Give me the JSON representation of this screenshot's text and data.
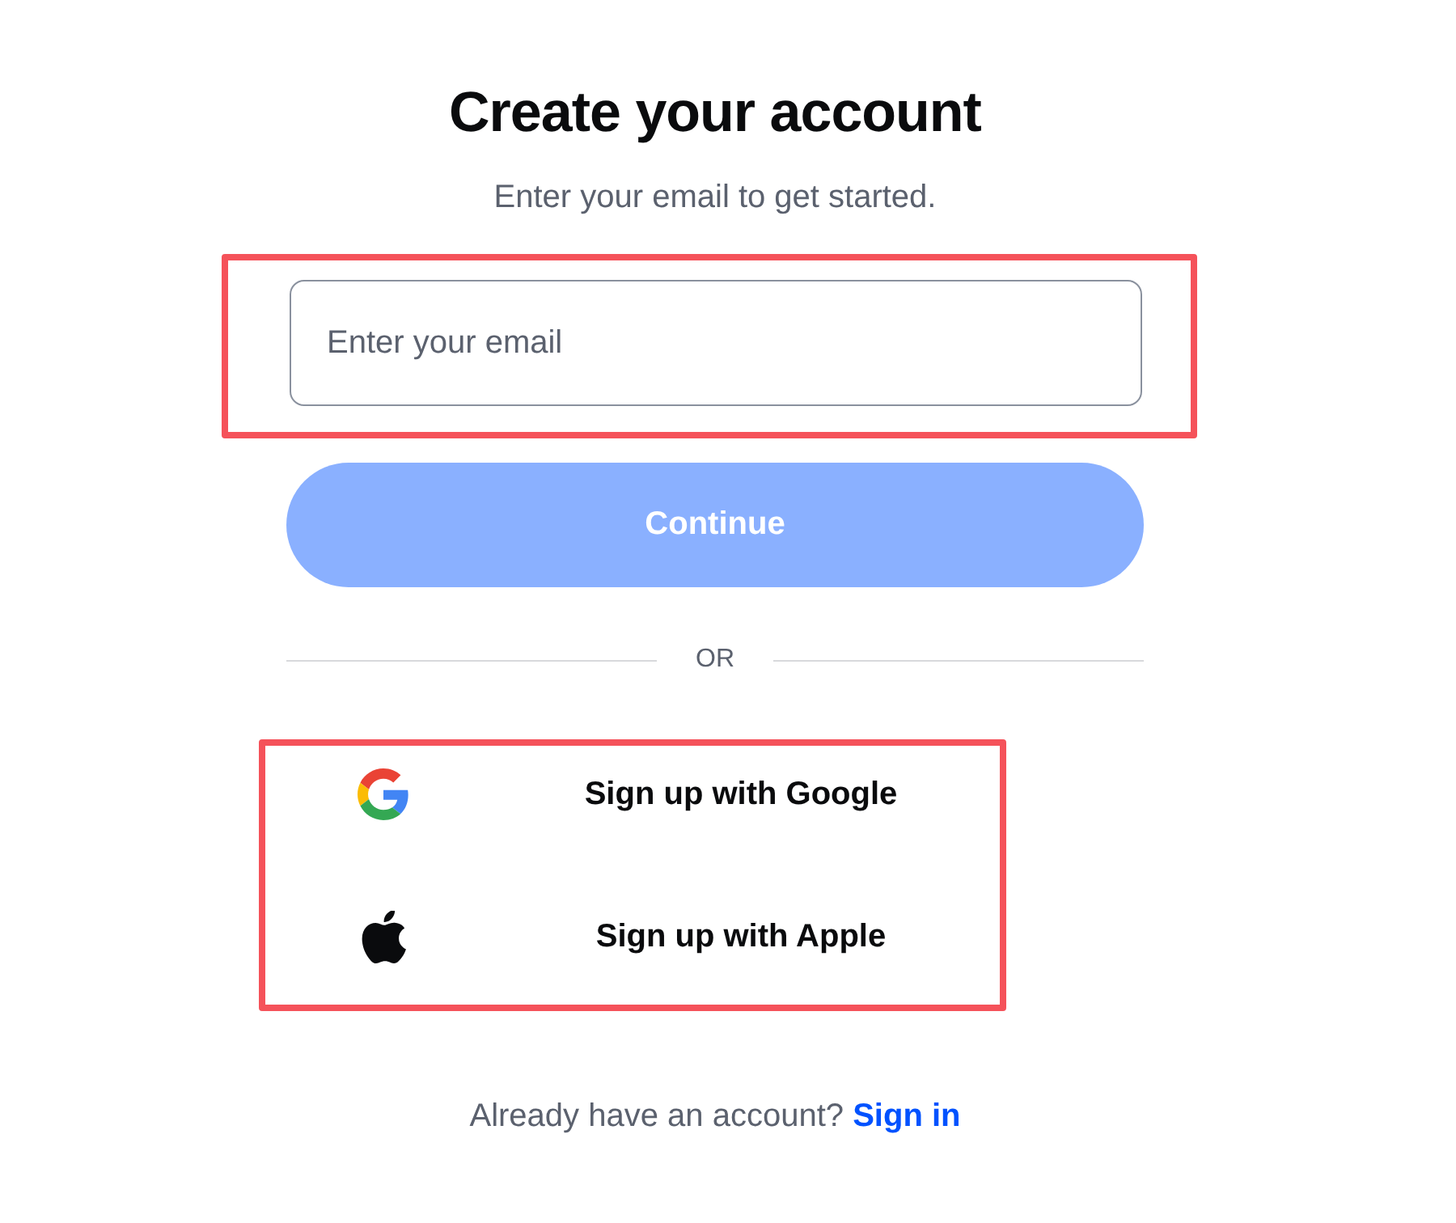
{
  "heading": {
    "title": "Create your account",
    "subtitle": "Enter your email to get started."
  },
  "email_field": {
    "placeholder": "Enter your email",
    "highlighted": true
  },
  "continue_button": {
    "label": "Continue",
    "disabled": true
  },
  "divider": {
    "label": "OR"
  },
  "social_buttons": {
    "highlighted": true,
    "items": [
      {
        "kind": "google",
        "label": "Sign up with Google"
      },
      {
        "kind": "apple",
        "label": "Sign up with Apple"
      }
    ]
  },
  "footer": {
    "text": "Already have an account?",
    "link": "Sign in"
  }
}
